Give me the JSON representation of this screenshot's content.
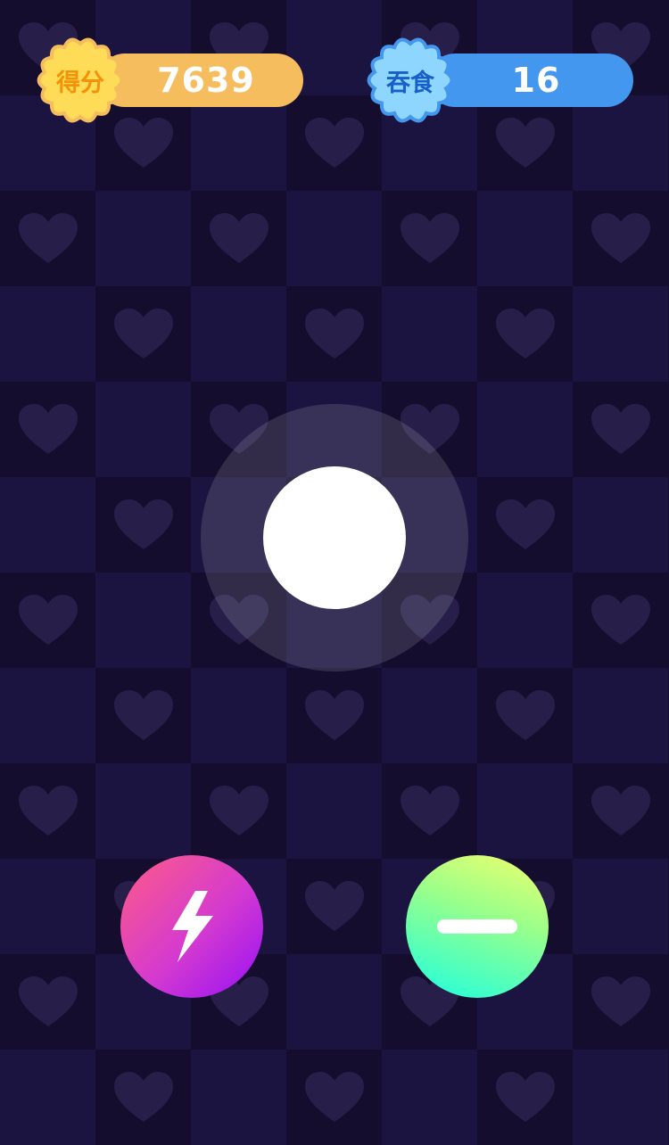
{
  "hud": {
    "score": {
      "label": "得分",
      "value": "7639",
      "icon": "flower-badge-icon",
      "badge_color": "#ffdc57",
      "pill_color": "#f6bd5e"
    },
    "eaten": {
      "label": "吞食",
      "value": "16",
      "icon": "flower-badge-icon",
      "badge_color": "#8fd6ff",
      "pill_color": "#4497ee"
    }
  },
  "board": {
    "cell_dark": "#140d2e",
    "cell_light": "#1b1340",
    "heart_color": "#271f4a",
    "pattern_icon": "heart-icon"
  },
  "controls": {
    "joystick": {
      "icon": "joystick-knob"
    },
    "boost_button": {
      "icon": "lightning-bolt-icon"
    },
    "split_button": {
      "icon": "minus-icon"
    }
  }
}
